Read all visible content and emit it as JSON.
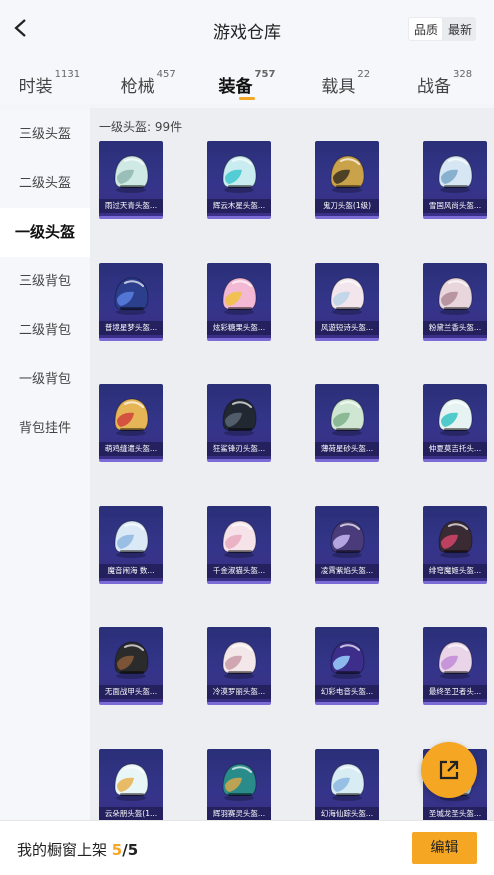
{
  "header": {
    "title": "游戏仓库",
    "sort_options": [
      "品质",
      "最新"
    ],
    "sort_active": "品质"
  },
  "tabs": [
    {
      "label": "时装",
      "count": "1131",
      "active": false
    },
    {
      "label": "枪械",
      "count": "457",
      "active": false
    },
    {
      "label": "装备",
      "count": "757",
      "active": true
    },
    {
      "label": "载具",
      "count": "22",
      "active": false
    },
    {
      "label": "战备",
      "count": "328",
      "active": false
    }
  ],
  "sidebar": {
    "items": [
      {
        "label": "三级头盔",
        "active": false
      },
      {
        "label": "二级头盔",
        "active": false
      },
      {
        "label": "一级头盔",
        "active": true
      },
      {
        "label": "三级背包",
        "active": false
      },
      {
        "label": "二级背包",
        "active": false
      },
      {
        "label": "一级背包",
        "active": false
      },
      {
        "label": "背包挂件",
        "active": false
      }
    ]
  },
  "section": {
    "label": "一级头盔: 99件"
  },
  "items": [
    {
      "name": "雨过天青头盔...",
      "color": "#cfe9e4",
      "accent": "#8fb7b0",
      "icon": "helmet-icon"
    },
    {
      "name": "辉云木星头盔...",
      "color": "#c8ecef",
      "accent": "#3fc7cf",
      "icon": "helmet-icon"
    },
    {
      "name": "鬼刀头盔(1级)",
      "color": "#c9a24a",
      "accent": "#3a3020",
      "icon": "helmet-icon"
    },
    {
      "name": "雪国风尚头盔...",
      "color": "#d6e6f2",
      "accent": "#7aa6c9",
      "icon": "helmet-icon"
    },
    {
      "name": "普境星梦头盔...",
      "color": "#2c3f8c",
      "accent": "#5a7fe0",
      "icon": "helmet-icon"
    },
    {
      "name": "炫彩糖果头盔...",
      "color": "#f3b9d4",
      "accent": "#f0c23c",
      "icon": "helmet-icon"
    },
    {
      "name": "风遊短诗头盔...",
      "color": "#f2e6ec",
      "accent": "#bcd4e8",
      "icon": "helmet-icon"
    },
    {
      "name": "粉黛兰香头盔...",
      "color": "#e8d6dc",
      "accent": "#b08a96",
      "icon": "helmet-icon"
    },
    {
      "name": "萌鸡缝遣头盔...",
      "color": "#e6b656",
      "accent": "#d0413c",
      "icon": "helmet-icon"
    },
    {
      "name": "狂鲨锋刃头盔...",
      "color": "#222831",
      "accent": "#5a6675",
      "icon": "helmet-icon"
    },
    {
      "name": "薄荷星砂头盔...",
      "color": "#cfe6d3",
      "accent": "#7fb08a",
      "icon": "helmet-icon"
    },
    {
      "name": "仲夏莫吉托头...",
      "color": "#e7f3f3",
      "accent": "#35c2c2",
      "icon": "helmet-icon"
    },
    {
      "name": "魔音闹海 数...",
      "color": "#dbe9f7",
      "accent": "#8fb6e0",
      "icon": "helmet-icon"
    },
    {
      "name": "千金淑猫头盔...",
      "color": "#f6e3ea",
      "accent": "#e9a9c0",
      "icon": "helmet-icon"
    },
    {
      "name": "凌霄紫焰头盔...",
      "color": "#4a3b7a",
      "accent": "#c7b8f2",
      "icon": "helmet-icon"
    },
    {
      "name": "绯穹魔姬头盔...",
      "color": "#3a2a34",
      "accent": "#d4456a",
      "icon": "helmet-icon"
    },
    {
      "name": "无面战甲头盔...",
      "color": "#2b2b2b",
      "accent": "#8a5a3a",
      "icon": "helmet-icon"
    },
    {
      "name": "冷漠罗丽头盔...",
      "color": "#f3e7ea",
      "accent": "#c99aa6",
      "icon": "helmet-icon"
    },
    {
      "name": "幻彩电音头盔...",
      "color": "#3c2e8a",
      "accent": "#9ad0ff",
      "icon": "helmet-icon"
    },
    {
      "name": "最终圣卫者头...",
      "color": "#e9d5e7",
      "accent": "#c18ad6",
      "icon": "helmet-icon"
    },
    {
      "name": "云朵朋头盔(1...",
      "color": "#e9f6f8",
      "accent": "#e7b04c",
      "icon": "helmet-icon"
    },
    {
      "name": "辉羽赛灵头盔...",
      "color": "#2a8c8a",
      "accent": "#d3a74a",
      "icon": "helmet-icon"
    },
    {
      "name": "幻海仙踪头盔...",
      "color": "#d8ecf4",
      "accent": "#8cb8e0",
      "icon": "helmet-icon"
    },
    {
      "name": "圣城龙圣头盔...",
      "color": "#b8d4ea",
      "accent": "#f5a623",
      "icon": "helmet-icon"
    }
  ],
  "footer": {
    "label": "我的橱窗上架",
    "count": "5",
    "separator": "/",
    "total": "5",
    "edit_label": "编辑"
  },
  "colors": {
    "accent": "#f5a623"
  }
}
